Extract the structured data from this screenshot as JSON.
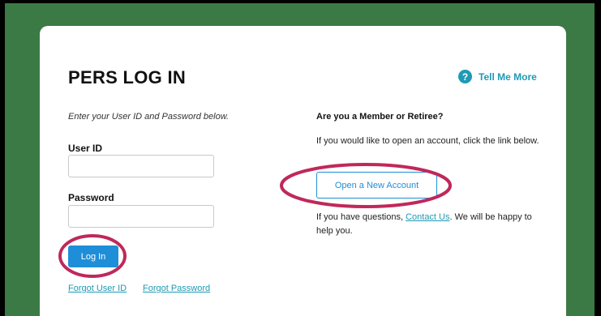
{
  "colors": {
    "background_green": "#3b7a45",
    "accent_blue": "#1f8ed8",
    "link_teal": "#1e9ab5",
    "annotation_red": "#c0285a"
  },
  "login": {
    "title": "PERS LOG IN",
    "tell_me_more": "Tell Me More",
    "instructions": "Enter your User ID and Password below.",
    "user_id_label": "User ID",
    "user_id_value": "",
    "password_label": "Password",
    "password_value": "",
    "login_button": "Log In",
    "forgot_user_id": "Forgot User ID",
    "forgot_password": "Forgot Password"
  },
  "member": {
    "heading": "Are you a Member or Retiree?",
    "open_text": "If you would like to open an account, click the link below.",
    "open_button": "Open a New Account",
    "questions_prefix": "If you have questions, ",
    "contact_link": "Contact Us",
    "questions_suffix": ". We will be happy to help you."
  },
  "icons": {
    "help": "help-circle-icon"
  }
}
